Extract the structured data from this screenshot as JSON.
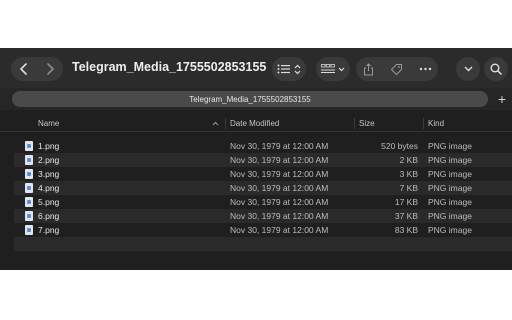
{
  "window": {
    "title": "Telegram_Media_1755502853155"
  },
  "toolbar": {
    "back_icon": "chevron-left-icon",
    "forward_icon": "chevron-right-icon",
    "view_icon": "list-view-icon",
    "group_icon": "group-grid-icon",
    "share_icon": "share-icon",
    "tag_icon": "tag-icon",
    "more_icon": "ellipsis-icon",
    "dropdown_icon": "chevron-down-icon",
    "search_icon": "search-icon"
  },
  "tabs": {
    "active_label": "Telegram_Media_1755502853155",
    "new_tab_label": "+"
  },
  "columns": {
    "name": "Name",
    "date": "Date Modified",
    "size": "Size",
    "kind": "Kind"
  },
  "files": [
    {
      "name": "1.png",
      "date": "Nov 30, 1979 at 12:00 AM",
      "size": "520 bytes",
      "kind": "PNG image"
    },
    {
      "name": "2.png",
      "date": "Nov 30, 1979 at 12:00 AM",
      "size": "2 KB",
      "kind": "PNG image"
    },
    {
      "name": "3.png",
      "date": "Nov 30, 1979 at 12:00 AM",
      "size": "3 KB",
      "kind": "PNG image"
    },
    {
      "name": "4.png",
      "date": "Nov 30, 1979 at 12:00 AM",
      "size": "7 KB",
      "kind": "PNG image"
    },
    {
      "name": "5.png",
      "date": "Nov 30, 1979 at 12:00 AM",
      "size": "17 KB",
      "kind": "PNG image"
    },
    {
      "name": "6.png",
      "date": "Nov 30, 1979 at 12:00 AM",
      "size": "37 KB",
      "kind": "PNG image"
    },
    {
      "name": "7.png",
      "date": "Nov 30, 1979 at 12:00 AM",
      "size": "83 KB",
      "kind": "PNG image"
    }
  ]
}
